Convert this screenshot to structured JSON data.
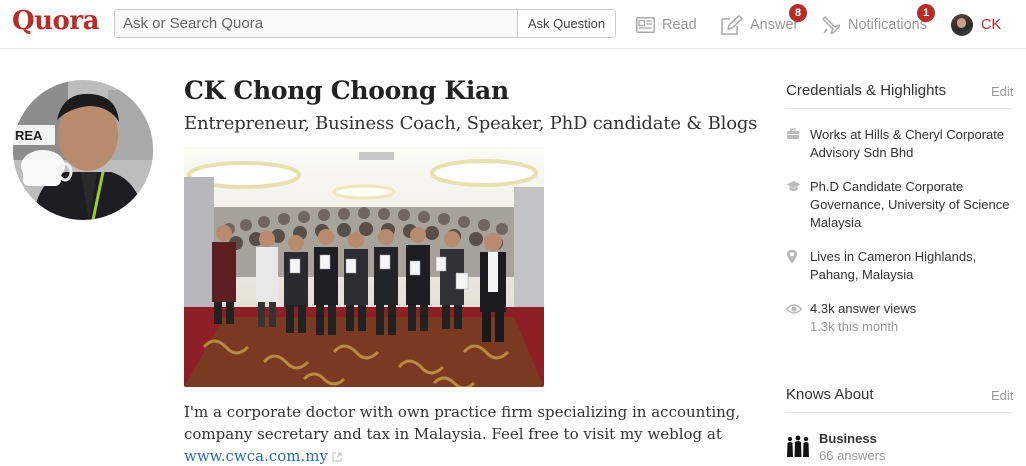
{
  "header": {
    "logo": "Quora",
    "search_placeholder": "Ask or Search Quora",
    "ask_button": "Ask Question",
    "nav": {
      "read": "Read",
      "answer": "Answer",
      "answer_badge": "8",
      "notifications": "Notifications",
      "notifications_badge": "1",
      "profile": "CK"
    },
    "icons": {
      "read": "read-icon",
      "answer": "pencil-icon",
      "notifications": "bell-icon"
    }
  },
  "profile": {
    "name": "CK Chong Choong Kian",
    "tagline": "Entrepreneur, Business Coach, Speaker, PhD candidate & Blogs",
    "bio_text": "I'm a corporate doctor with own practice firm specializing in accounting, company secretary and tax in Malaysia. Feel free to visit my weblog at",
    "bio_link": "www.cwca.com.my"
  },
  "sidebar": {
    "credentials": {
      "heading": "Credentials & Highlights",
      "edit": "Edit",
      "items": [
        {
          "icon": "briefcase-icon",
          "text": "Works at Hills & Cheryl Corporate Advisory Sdn Bhd"
        },
        {
          "icon": "graduation-cap-icon",
          "text": "Ph.D Candidate Corporate Governance, University of Science Malaysia"
        },
        {
          "icon": "location-pin-icon",
          "text": "Lives in Cameron Highlands, Pahang, Malaysia"
        },
        {
          "icon": "eye-icon",
          "text": "4.3k answer views",
          "sub": "1.3k this month"
        }
      ]
    },
    "knows_about": {
      "heading": "Knows About",
      "edit": "Edit",
      "topics": [
        {
          "name": "Business",
          "count": "66 answers"
        }
      ]
    }
  },
  "colors": {
    "brand": "#b92b27",
    "link": "#2b6dad",
    "muted": "#999999"
  }
}
